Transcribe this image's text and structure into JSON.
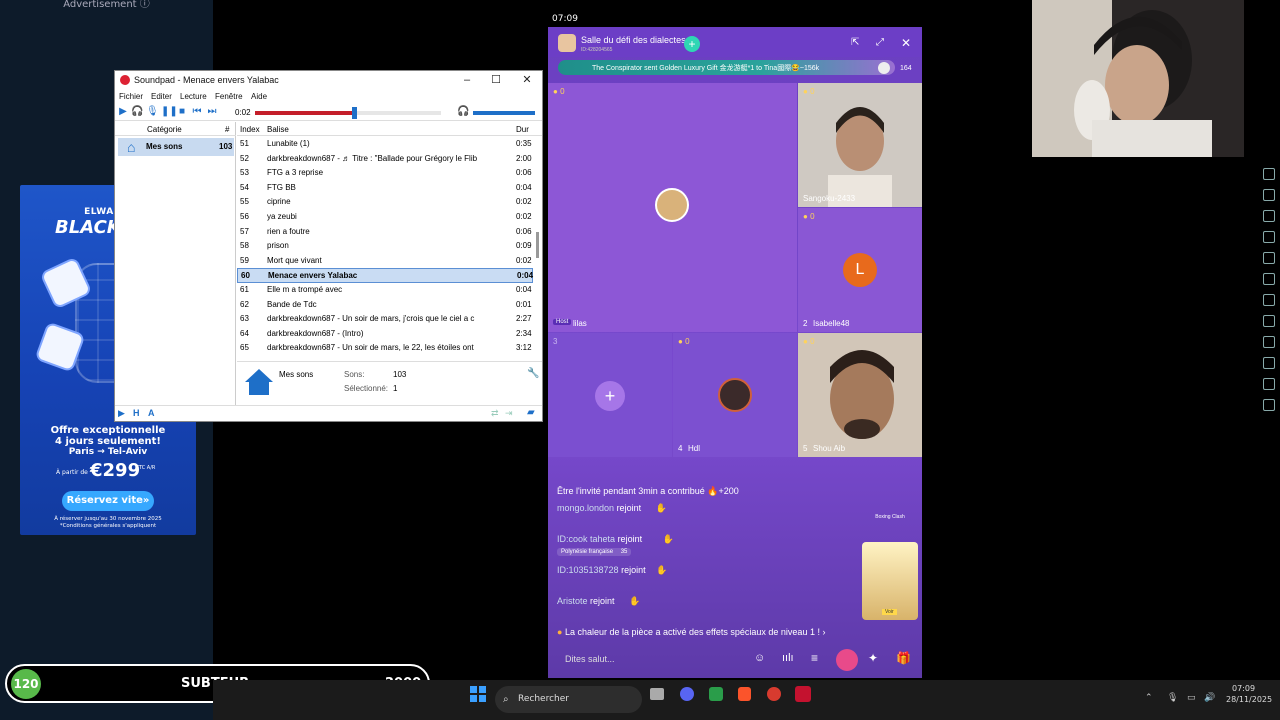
{
  "ad": {
    "header": "Advertisement",
    "brand": "ELWALTA",
    "headline": "BLACK FLY",
    "offer_line1": "Offre exceptionnelle",
    "offer_line2": "4 jours seulement!",
    "route": "Paris → Tel-Aviv",
    "price_prefix": "À partir de",
    "price": "€299",
    "price_suffix": "TTC A/R",
    "cta": "Réservez vite»",
    "fine_print1": "À réserver jusqu'au 30 novembre 2025",
    "fine_print2": "*Conditions générales s'appliquent"
  },
  "soundpad": {
    "title": "Soundpad - Menace envers Yalabac",
    "menu": [
      "Fichier",
      "Editer",
      "Lecture",
      "Fenêtre",
      "Aide"
    ],
    "time": "0:02",
    "progress": 0.53,
    "category_header": "Catégorie",
    "count_header": "#",
    "category_name": "Mes sons",
    "category_count": "103",
    "columns": {
      "index": "Index",
      "tag": "Balise",
      "duration": "Dur"
    },
    "rows": [
      {
        "i": "51",
        "name": "Lunabite (1)",
        "dur": "0:35"
      },
      {
        "i": "52",
        "name": "darkbreakdown687 - ♬ Titre : \"Ballade pour Grégory le Flib",
        "dur": "2:00"
      },
      {
        "i": "53",
        "name": "FTG a 3 reprise",
        "dur": "0:06"
      },
      {
        "i": "54",
        "name": "FTG BB",
        "dur": "0:04"
      },
      {
        "i": "55",
        "name": "ciprine",
        "dur": "0:02"
      },
      {
        "i": "56",
        "name": "ya zeubi",
        "dur": "0:02"
      },
      {
        "i": "57",
        "name": "rien a foutre",
        "dur": "0:06"
      },
      {
        "i": "58",
        "name": "prison",
        "dur": "0:09"
      },
      {
        "i": "59",
        "name": "Mort que vivant",
        "dur": "0:02"
      },
      {
        "i": "60",
        "name": "Menace envers Yalabac",
        "dur": "0:04",
        "selected": true
      },
      {
        "i": "61",
        "name": "Elle m a trompé avec",
        "dur": "0:04"
      },
      {
        "i": "62",
        "name": "Bande de Tdc",
        "dur": "0:01"
      },
      {
        "i": "63",
        "name": "darkbreakdown687 - Un soir de mars, j'crois que le ciel a c",
        "dur": "2:27"
      },
      {
        "i": "64",
        "name": "darkbreakdown687 - (Intro)",
        "dur": "2:34"
      },
      {
        "i": "65",
        "name": "darkbreakdown687 - Un soir de mars, le 22, les étoiles ont",
        "dur": "3:12"
      }
    ],
    "info_name": "Mes sons",
    "sons_label": "Sons:",
    "sons_value": "103",
    "selected_label": "Sélectionné:",
    "selected_value": "1"
  },
  "tiktok": {
    "clock": "07:09",
    "room_title": "Salle du défi des dialectes",
    "room_id": "ID:428204565",
    "gift_banner": "The Conspirator sent Golden Luxury Gift 金龙游艇*1 to  Tina國際😂~156k",
    "viewer_count": "164",
    "tiles": [
      {
        "badge": "0",
        "label": "Host",
        "name": "lilas"
      },
      {
        "badge": "0",
        "name": "Sangoku-2433"
      },
      {
        "badge": "0",
        "initial": "L",
        "num": "2",
        "name": "Isabelle48"
      },
      {
        "badge": "3"
      },
      {
        "badge": "0",
        "num": "4",
        "name": "Hdl"
      },
      {
        "badge": "0",
        "num": "5",
        "name": "Shou Aib"
      }
    ],
    "chat": [
      {
        "text": "Être l'invité pendant 3min a contribué 🔥+200"
      },
      {
        "user": "mongo.london",
        "action": "rejoint"
      },
      {
        "user": "ID:cook taheta",
        "action": "rejoint",
        "sub": "Polynésie française",
        "subcount": "35"
      },
      {
        "user": "ID:1035138728",
        "action": "rejoint"
      },
      {
        "user": "Aristote",
        "action": "rejoint"
      }
    ],
    "system_message": "La chaleur de la pièce a activé des effets spéciaux de niveau 1 !",
    "boxing_label": "Boxing Clash",
    "promo_button": "Voir",
    "input_placeholder": "Dites salut..."
  },
  "streamer_bar": {
    "level": "120",
    "name": "SUBTEUB",
    "score": "2000"
  },
  "taskbar": {
    "search_placeholder": "Rechercher",
    "time": "07:09",
    "date": "28/11/2025"
  }
}
